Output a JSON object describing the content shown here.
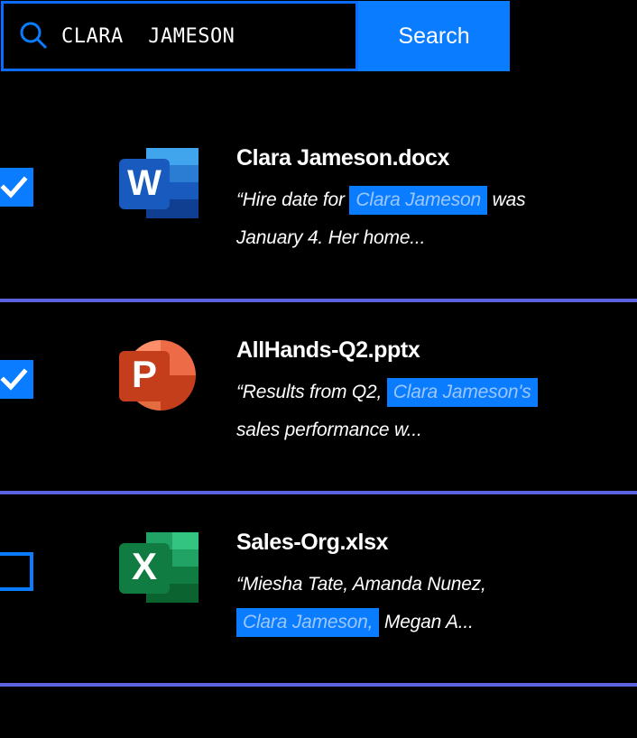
{
  "search": {
    "value": "CLARA  JAMESON",
    "placeholder": "Search",
    "button_label": "Search",
    "icon": "search-icon",
    "accent": "#0a7cff",
    "border": "#0a6bff"
  },
  "theme": {
    "background": "#000000",
    "divider": "#5b63e0",
    "highlight_bg": "#0a7cff",
    "highlight_fg": "#9cc7fb",
    "text": "#ffffff"
  },
  "results": [
    {
      "checked": true,
      "checkbox_state": "checked",
      "icon": "word-document-icon",
      "icon_letter": "W",
      "title": "Clara Jameson.docx",
      "snippet_line1_pre": "“Hire date for ",
      "snippet_highlight": "Clara Jameson",
      "snippet_line1_post": " was",
      "snippet_line2": "January 4. Her home..."
    },
    {
      "checked": true,
      "checkbox_state": "checked",
      "icon": "powerpoint-presentation-icon",
      "icon_letter": "P",
      "title": "AllHands-Q2.pptx",
      "snippet_line1_pre": "“Results from Q2, ",
      "snippet_highlight": "Clara Jameson's",
      "snippet_line1_post": "",
      "snippet_line2": "sales performance w..."
    },
    {
      "checked": false,
      "checkbox_state": "unchecked",
      "icon": "excel-spreadsheet-icon",
      "icon_letter": "X",
      "title": "Sales-Org.xlsx",
      "snippet_line1_pre": "“Miesha Tate, Amanda Nunez,",
      "snippet_highlight": "Clara Jameson,",
      "snippet_line1_post": " Megan A...",
      "snippet_line2": ""
    }
  ]
}
